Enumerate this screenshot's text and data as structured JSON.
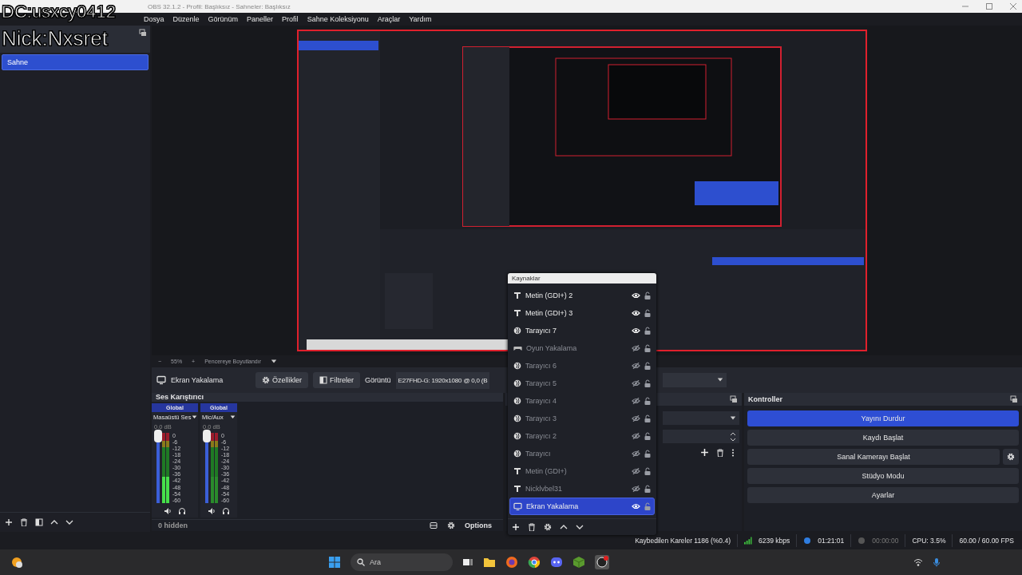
{
  "overlay_texts": [
    "DC:usxcy0412",
    "Nick:Nxsret"
  ],
  "window": {
    "title": "OBS 32.1.2 - Profil: Başlıksız - Sahneler: Başlıksız"
  },
  "menu": [
    "Dosya",
    "Düzenle",
    "Görünüm",
    "Paneller",
    "Profil",
    "Sahne Koleksiyonu",
    "Araçlar",
    "Yardım"
  ],
  "scenes": {
    "items": [
      {
        "label": "Sahne",
        "selected": true
      }
    ]
  },
  "zoom_bar": {
    "minus": "−",
    "zoom": "55%",
    "plus": "+",
    "fit": "Pencereye Boyutlandır"
  },
  "source_toolbar": {
    "source": "Ekran Yakalama",
    "properties": "Özellikler",
    "filters": "Filtreler",
    "display_label": "Görüntü",
    "display_value": "E27FHD-G: 1920x1080 @ 0,0 (B"
  },
  "mixer": {
    "title": "Ses Karıştırıcı",
    "channels": [
      {
        "scope": "Global",
        "name": "Masaüstü Ses",
        "reading": "0.0 dB",
        "level": 1,
        "scale": [
          "0",
          "-6",
          "-12",
          "-18",
          "-24",
          "-30",
          "-36",
          "-42",
          "-48",
          "-54",
          "-60"
        ]
      },
      {
        "scope": "Global",
        "name": "Mic/Aux",
        "reading": "0.0 dB",
        "level": 1,
        "scale": [
          "0",
          "-6",
          "-12",
          "-18",
          "-24",
          "-30",
          "-36",
          "-42",
          "-48",
          "-54",
          "-60"
        ]
      }
    ],
    "hidden_count": "0 hidden",
    "options": "Options"
  },
  "controls": {
    "title": "Kontroller",
    "buttons": [
      {
        "label": "Yayını Durdur",
        "active": true,
        "settings": false
      },
      {
        "label": "Kaydı Başlat",
        "active": false,
        "settings": false
      },
      {
        "label": "Sanal Kamerayı Başlat",
        "active": false,
        "settings": true
      },
      {
        "label": "Stüdyo Modu",
        "active": false,
        "settings": false
      },
      {
        "label": "Ayarlar",
        "active": false,
        "settings": false
      }
    ]
  },
  "sources": {
    "title": "Kaynaklar",
    "items": [
      {
        "label": "Metin (GDI+) 2",
        "kind": "text",
        "visible": true,
        "selected": false
      },
      {
        "label": "Metin (GDI+) 3",
        "kind": "text",
        "visible": true,
        "selected": false
      },
      {
        "label": "Tarayıcı 7",
        "kind": "browser",
        "visible": true,
        "selected": false
      },
      {
        "label": "Oyun Yakalama",
        "kind": "game",
        "visible": false,
        "selected": false
      },
      {
        "label": "Tarayıcı 6",
        "kind": "browser",
        "visible": false,
        "selected": false
      },
      {
        "label": "Tarayıcı 5",
        "kind": "browser",
        "visible": false,
        "selected": false
      },
      {
        "label": "Tarayıcı 4",
        "kind": "browser",
        "visible": false,
        "selected": false
      },
      {
        "label": "Tarayıcı 3",
        "kind": "browser",
        "visible": false,
        "selected": false
      },
      {
        "label": "Tarayıcı 2",
        "kind": "browser",
        "visible": false,
        "selected": false
      },
      {
        "label": "Tarayıcı",
        "kind": "browser",
        "visible": false,
        "selected": false
      },
      {
        "label": "Metin (GDI+)",
        "kind": "text",
        "visible": false,
        "selected": false
      },
      {
        "label": "Nicklvbel31",
        "kind": "text",
        "visible": false,
        "selected": false
      },
      {
        "label": "Ekran Yakalama",
        "kind": "screen",
        "visible": true,
        "selected": true
      }
    ]
  },
  "status_bar": {
    "dropped": "Kaybedilen Kareler 1186 (%0.4)",
    "bitrate": "6239 kbps",
    "streaming": true,
    "live_time": "01:21:01",
    "recording": false,
    "rec_time": "00:00:00",
    "cpu": "CPU: 3.5%",
    "fps": "60.00 / 60.00 FPS"
  },
  "taskbar": {
    "search_placeholder": "Ara"
  }
}
